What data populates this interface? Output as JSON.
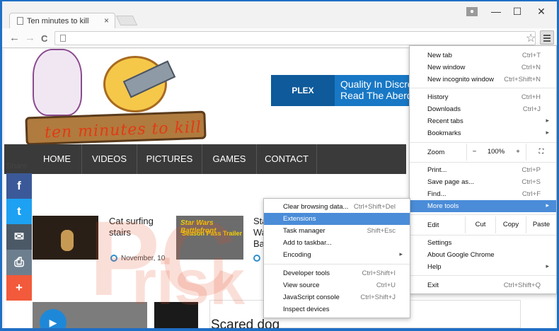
{
  "tab": {
    "title": "Ten minutes to kill",
    "close": "×"
  },
  "window_controls": {
    "minimize": "—",
    "maximize": "☐",
    "close": "✕"
  },
  "toolbar": {
    "back": "←",
    "forward": "→",
    "reload": "C",
    "star": "☆"
  },
  "site": {
    "logo_text": "ten minutes to kill",
    "ad": {
      "logo": "PLEX",
      "line1": "Quality In Discre",
      "line2": "Read The Aberd"
    },
    "nav": [
      "HOME",
      "VIDEOS",
      "PICTURES",
      "GAMES",
      "CONTACT"
    ],
    "share_label": "Share",
    "share_buttons": [
      {
        "name": "facebook",
        "glyph": "f",
        "color": "#3b5998"
      },
      {
        "name": "twitter",
        "glyph": "t",
        "color": "#1da1f2"
      },
      {
        "name": "email",
        "glyph": "✉",
        "color": "#4b5966"
      },
      {
        "name": "print",
        "glyph": "⎙",
        "color": "#6d7f8f"
      },
      {
        "name": "more",
        "glyph": "+",
        "color": "#f25a3b"
      }
    ],
    "posts": [
      {
        "title": "Cat surfing stairs",
        "date": "November, 10"
      },
      {
        "title": "Star Wars Battlefront",
        "thumb_line1": "Star Wars Battlefront",
        "thumb_line2": "Season Pass Trailer"
      }
    ],
    "bottom_title": "Scared dog",
    "video_glyph": "▶"
  },
  "main_menu": {
    "items": [
      {
        "label": "New tab",
        "shortcut": "Ctrl+T"
      },
      {
        "label": "New window",
        "shortcut": "Ctrl+N"
      },
      {
        "label": "New incognito window",
        "shortcut": "Ctrl+Shift+N"
      },
      {
        "label": "History",
        "shortcut": "Ctrl+H"
      },
      {
        "label": "Downloads",
        "shortcut": "Ctrl+J"
      },
      {
        "label": "Recent tabs",
        "shortcut": ""
      },
      {
        "label": "Bookmarks",
        "shortcut": ""
      },
      {
        "label": "Print...",
        "shortcut": "Ctrl+P"
      },
      {
        "label": "Save page as...",
        "shortcut": "Ctrl+S"
      },
      {
        "label": "Find...",
        "shortcut": "Ctrl+F"
      },
      {
        "label": "More tools",
        "shortcut": ""
      },
      {
        "label": "Settings",
        "shortcut": ""
      },
      {
        "label": "About Google Chrome",
        "shortcut": ""
      },
      {
        "label": "Help",
        "shortcut": ""
      },
      {
        "label": "Exit",
        "shortcut": "Ctrl+Shift+Q"
      }
    ],
    "zoom": {
      "label": "Zoom",
      "minus": "−",
      "value": "100%",
      "plus": "+",
      "fullscreen": "⛶"
    },
    "edit": {
      "label": "Edit",
      "cut": "Cut",
      "copy": "Copy",
      "paste": "Paste"
    },
    "arrow": "▸"
  },
  "more_tools_menu": {
    "items": [
      {
        "label": "Clear browsing data...",
        "shortcut": "Ctrl+Shift+Del"
      },
      {
        "label": "Extensions",
        "shortcut": ""
      },
      {
        "label": "Task manager",
        "shortcut": "Shift+Esc"
      },
      {
        "label": "Add to taskbar...",
        "shortcut": ""
      },
      {
        "label": "Encoding",
        "shortcut": ""
      },
      {
        "label": "Developer tools",
        "shortcut": "Ctrl+Shift+I"
      },
      {
        "label": "View source",
        "shortcut": "Ctrl+U"
      },
      {
        "label": "JavaScript console",
        "shortcut": "Ctrl+Shift+J"
      },
      {
        "label": "Inspect devices",
        "shortcut": ""
      }
    ]
  }
}
